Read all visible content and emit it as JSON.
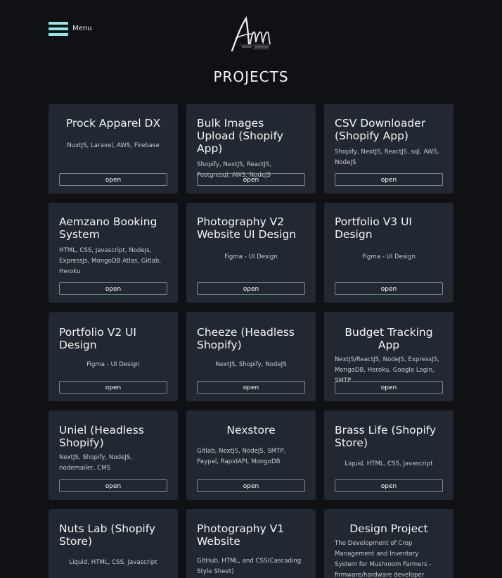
{
  "menu": {
    "label": "Menu"
  },
  "logo": {
    "text": "Am"
  },
  "page_title": "PROJECTS",
  "open_label": "open",
  "cards": [
    {
      "title": "Prock Apparel DX",
      "tech": "NuxtJS, Laravel, AWS, Firebase"
    },
    {
      "title": "Bulk Images Upload (Shopify App)",
      "tech": "Shopify, NextJS, ReactJS, Postgresql, AWS, NodeJS"
    },
    {
      "title": "CSV Downloader (Shopify App)",
      "tech": "Shopify, NextJS, ReactJS, sql, AWS, NodeJS"
    },
    {
      "title": "Aemzano Booking System",
      "tech": "HTML, CSS, Javascript, NodeJs, ExpressJs, MongoDB Atlas, Gitlab, Heroku"
    },
    {
      "title": "Photography V2 Website UI Design",
      "tech": "Figma - UI Design"
    },
    {
      "title": "Portfolio V3 UI Design",
      "tech": "Figma - UI Design"
    },
    {
      "title": "Portfolio V2 UI Design",
      "tech": "Figma - UI Design"
    },
    {
      "title": "Cheeze (Headless Shopify)",
      "tech": "NextJS, Shopify, NodeJS"
    },
    {
      "title": "Budget Tracking App",
      "tech": "NextJS/ReactJS, NodeJS, ExpressJS, MongoDB, Heroku, Google Login, SMTP"
    },
    {
      "title": "Uniel (Headless Shopify)",
      "tech": "NextJS, Shopify, NodeJS, nodemailer, CMS"
    },
    {
      "title": "Nexstore",
      "tech": "Gitlab, NextJS, NodeJS, SMTP, Paypal, RapidAPI, MongoDB"
    },
    {
      "title": "Brass Life (Shopify Store)",
      "tech": "Liquid, HTML, CSS, Javascript"
    },
    {
      "title": "Nuts Lab (Shopify Store)",
      "tech": "Liquid, HTML, CSS, Javascript"
    },
    {
      "title": "Photography V1 Website",
      "tech": "GitHub, HTML, and CSS(Cascading Style Sheet)"
    },
    {
      "title": "Design Project",
      "tech": "The Development of Crop Management and Inventory System for Mushroom Farmers - firmware/hardware developer"
    }
  ]
}
